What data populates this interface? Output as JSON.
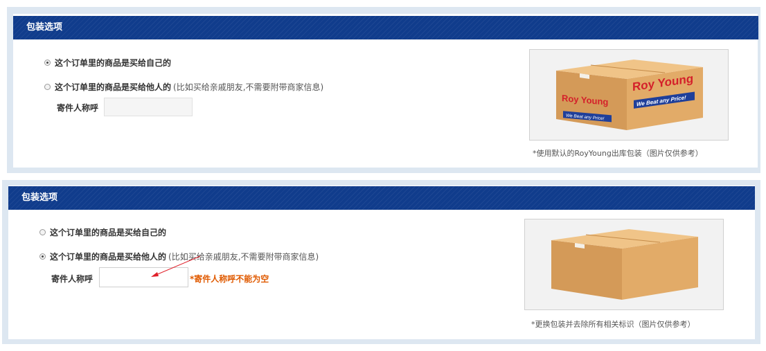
{
  "panel1": {
    "title": "包装选项",
    "option_self": "这个订单里的商品是买给自己的",
    "option_other": "这个订单里的商品是买给他人的",
    "option_other_note": "(比如买给亲戚朋友,不需要附带商家信息)",
    "sender_label": "寄件人称呼",
    "sender_value": "",
    "selected": "self",
    "caption": "*使用默认的RoyYoung出库包装（图片仅供参考）",
    "box_brand": "Roy Young",
    "box_slogan": "We Beat any Price!",
    "box_label_small": "DISCOUNT CENTER"
  },
  "panel2": {
    "title": "包装选项",
    "option_self": "这个订单里的商品是买给自己的",
    "option_other": "这个订单里的商品是买给他人的",
    "option_other_note": "(比如买给亲戚朋友,不需要附带商家信息)",
    "sender_label": "寄件人称呼",
    "sender_value": "",
    "selected": "other",
    "error": "*寄件人称呼不能为空",
    "caption": "*更换包装并去除所有相关标识（图片仅供参考）"
  },
  "colors": {
    "header_bg": "#103c8c",
    "error": "#e05a00",
    "box": "#d9a15f",
    "arrow": "#e0202a"
  }
}
